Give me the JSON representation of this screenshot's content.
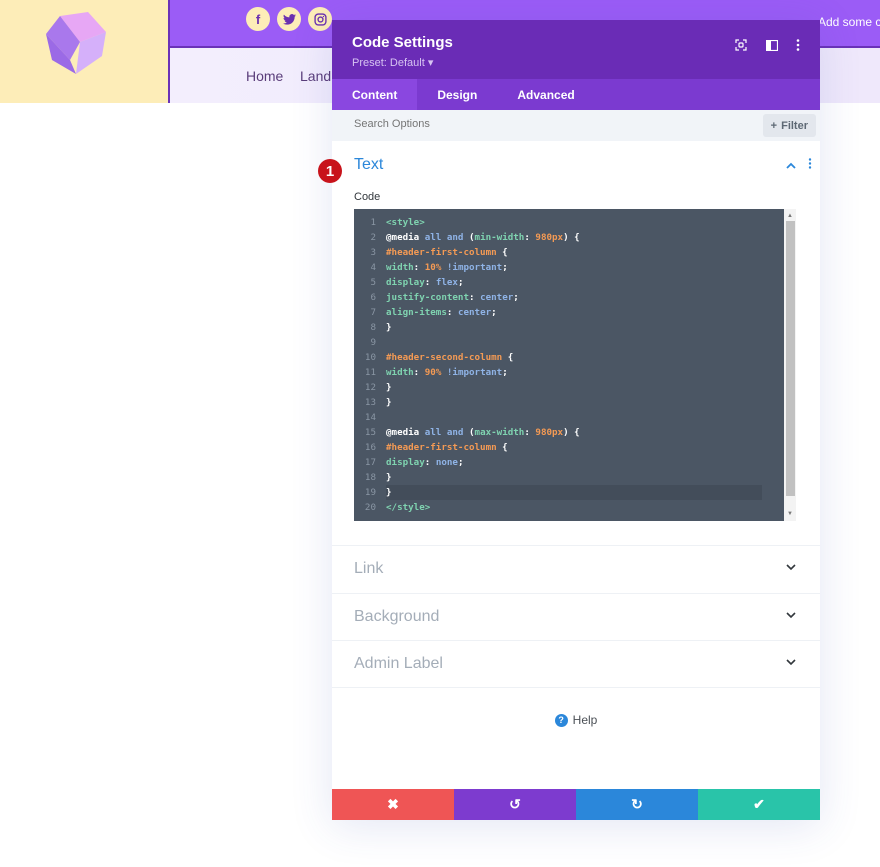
{
  "site": {
    "social": [
      {
        "name": "facebook-icon",
        "glyph": "f"
      },
      {
        "name": "twitter-icon",
        "glyph": "🐦"
      },
      {
        "name": "instagram-icon",
        "glyph": "◎"
      }
    ],
    "topbar_text": "Add some c",
    "nav": [
      "Home",
      "Land"
    ]
  },
  "modal": {
    "title": "Code Settings",
    "preset": "Preset: Default ▾",
    "tabs": [
      {
        "label": "Content",
        "active": true
      },
      {
        "label": "Design",
        "active": false
      },
      {
        "label": "Advanced",
        "active": false
      }
    ],
    "search_placeholder": "Search Options",
    "filter_label": "Filter",
    "section": {
      "title": "Text",
      "code_label": "Code",
      "badge": "1"
    },
    "code_lines": [
      [
        [
          "t-tag",
          "<style>"
        ]
      ],
      [
        [
          "t-at",
          "@media "
        ],
        [
          "t-kw",
          "all and "
        ],
        [
          "t-pun",
          "("
        ],
        [
          "t-prop",
          "min-width"
        ],
        [
          "t-pun",
          ": "
        ],
        [
          "t-num",
          "980px"
        ],
        [
          "t-pun",
          ") {"
        ]
      ],
      [
        [
          "t-sel",
          "#header-first-column "
        ],
        [
          "t-pun",
          "{"
        ]
      ],
      [
        [
          "t-prop",
          "width"
        ],
        [
          "t-pun",
          ": "
        ],
        [
          "t-num",
          "10% "
        ],
        [
          "t-imp",
          "!important"
        ],
        [
          "t-pun",
          ";"
        ]
      ],
      [
        [
          "t-prop",
          "display"
        ],
        [
          "t-pun",
          ": "
        ],
        [
          "t-val",
          "flex"
        ],
        [
          "t-pun",
          ";"
        ]
      ],
      [
        [
          "t-prop",
          "justify-content"
        ],
        [
          "t-pun",
          ": "
        ],
        [
          "t-val",
          "center"
        ],
        [
          "t-pun",
          ";"
        ]
      ],
      [
        [
          "t-prop",
          "align-items"
        ],
        [
          "t-pun",
          ": "
        ],
        [
          "t-val",
          "center"
        ],
        [
          "t-pun",
          ";"
        ]
      ],
      [
        [
          "t-pun",
          "}"
        ]
      ],
      [],
      [
        [
          "t-sel",
          "#header-second-column "
        ],
        [
          "t-pun",
          "{"
        ]
      ],
      [
        [
          "t-prop",
          "width"
        ],
        [
          "t-pun",
          ": "
        ],
        [
          "t-num",
          "90% "
        ],
        [
          "t-imp",
          "!important"
        ],
        [
          "t-pun",
          ";"
        ]
      ],
      [
        [
          "t-pun",
          "}"
        ]
      ],
      [
        [
          "t-pun",
          "}"
        ]
      ],
      [],
      [
        [
          "t-at",
          "@media "
        ],
        [
          "t-kw",
          "all and "
        ],
        [
          "t-pun",
          "("
        ],
        [
          "t-prop",
          "max-width"
        ],
        [
          "t-pun",
          ": "
        ],
        [
          "t-num",
          "980px"
        ],
        [
          "t-pun",
          ") {"
        ]
      ],
      [
        [
          "t-sel",
          "#header-first-column "
        ],
        [
          "t-pun",
          "{"
        ]
      ],
      [
        [
          "t-prop",
          "display"
        ],
        [
          "t-pun",
          ": "
        ],
        [
          "t-val",
          "none"
        ],
        [
          "t-pun",
          ";"
        ]
      ],
      [
        [
          "t-pun",
          "}"
        ]
      ],
      [
        [
          "t-pun",
          "}"
        ]
      ],
      [
        [
          "t-tag",
          "</style>"
        ]
      ]
    ],
    "active_line": 19,
    "collapsed_sections": [
      "Link",
      "Background",
      "Admin Label"
    ],
    "help_label": "Help",
    "footer": {
      "cancel": "✖",
      "undo": "↺",
      "redo": "↻",
      "save": "✔"
    }
  },
  "colors": {
    "header": "#6a2cb6",
    "tabs": "#7b3ad0",
    "accent_blue": "#2b87da",
    "cancel": "#ef5555",
    "undo": "#7d3bcf",
    "redo": "#2b87da",
    "save": "#29c4a9",
    "editor_bg": "#4b5664"
  }
}
